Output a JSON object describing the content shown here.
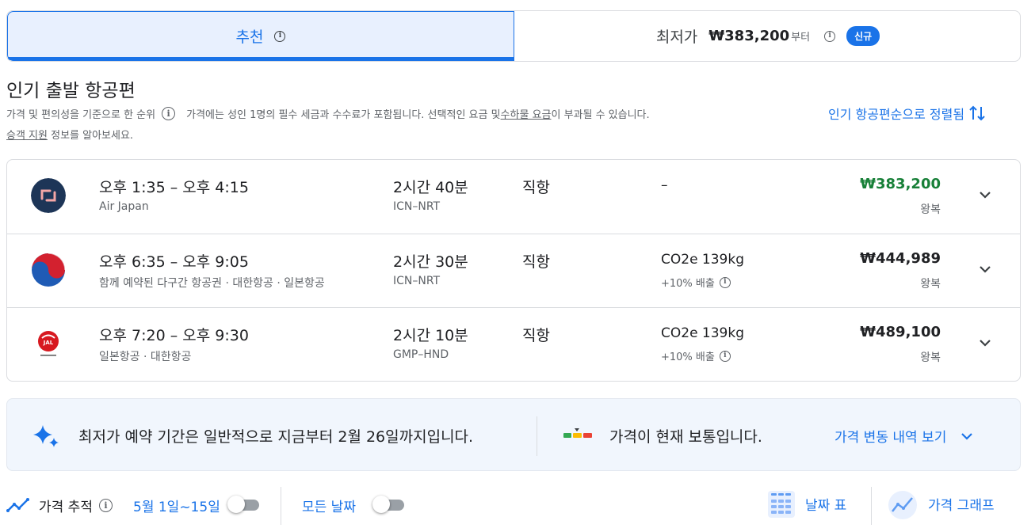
{
  "tabs": {
    "recommended_label": "추천",
    "cheapest_label": "최저가",
    "cheapest_price": "₩383,200",
    "cheapest_suffix": "부터",
    "new_badge": "신규"
  },
  "section": {
    "title": "인기 출발 항공편",
    "subtitle_rank": "가격 및 편의성을 기준으로 한 순위",
    "subtitle_fees_a": "가격에는 성인 1명의 필수 세금과 수수료가 포함됩니다. 선택적인 요금 및 ",
    "subtitle_fees_link": "수하물 요금",
    "subtitle_fees_b": "이 부과될 수 있습니다.",
    "support_link": "승객 지원",
    "support_rest": " 정보를 알아보세요.",
    "sort_label": "인기 항공편순으로 정렬됨"
  },
  "flights": [
    {
      "times": "오후 1:35 – 오후 4:15",
      "carrier": "Air Japan",
      "duration": "2시간 40분",
      "route": "ICN–NRT",
      "stops": "직항",
      "emission": "–",
      "emission_note": "",
      "price": "₩383,200",
      "price_type": "왕복",
      "logo_icon": "air-japan-logo"
    },
    {
      "times": "오후 6:35 – 오후 9:05",
      "carrier": "함께 예약된 다구간 항공권 · 대한항공 · 일본항공",
      "duration": "2시간 30분",
      "route": "ICN–NRT",
      "stops": "직항",
      "emission": "CO2e 139kg",
      "emission_note": "+10% 배출",
      "price": "₩444,989",
      "price_type": "왕복",
      "logo_icon": "korean-air-logo"
    },
    {
      "times": "오후 7:20 – 오후 9:30",
      "carrier": "일본항공 · 대한항공",
      "duration": "2시간 10분",
      "route": "GMP–HND",
      "stops": "직항",
      "emission": "CO2e 139kg",
      "emission_note": "+10% 배출",
      "price": "₩489,100",
      "price_type": "왕복",
      "logo_icon": "japan-airlines-logo"
    }
  ],
  "insights": {
    "booking_text": "최저가 예약 기간은 일반적으로 지금부터 2월 26일까지입니다.",
    "price_level_text": "가격이 현재 보통입니다.",
    "history_link": "가격 변동 내역 보기"
  },
  "bottom": {
    "track_label": "가격 추적",
    "track_dates": "5월 1일~15일",
    "all_dates": "모든 날짜",
    "date_grid": "날짜 표",
    "price_graph": "가격 그래프"
  },
  "colors": {
    "accent": "#1a73e8",
    "cheapest_price": "#188038",
    "gauge": [
      "#34a853",
      "#fbbc04",
      "#ea4335"
    ]
  }
}
